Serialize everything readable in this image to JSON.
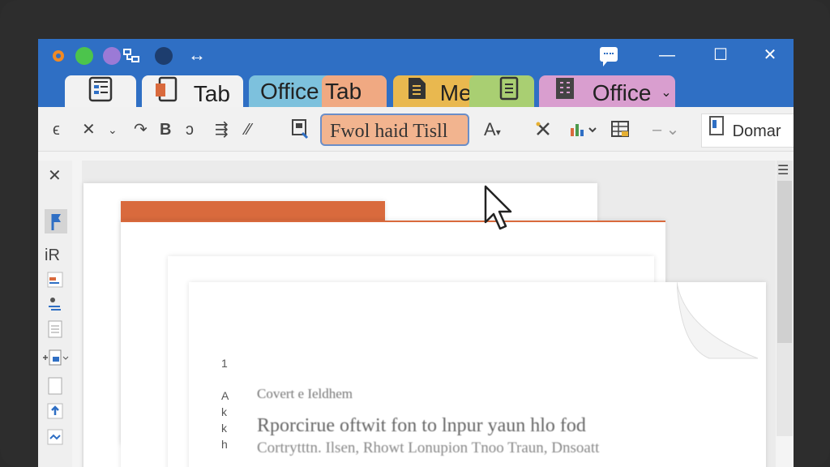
{
  "window": {
    "minimize_glyph": "—",
    "maximize_glyph": "☐",
    "close_glyph": "✕",
    "nav_glyph": "↔"
  },
  "tabs": [
    {
      "label": "",
      "icon": "document-list-icon"
    },
    {
      "label": "Tab",
      "icon": "document-orange-icon"
    },
    {
      "label": "Office",
      "icon": ""
    },
    {
      "label": "Tab",
      "icon": ""
    },
    {
      "label": "Me",
      "icon": "dark-document-icon"
    },
    {
      "label": "",
      "icon": "document-lines-icon"
    },
    {
      "label": "Office",
      "icon": "building-icon"
    }
  ],
  "ribbon": {
    "items": [
      "ϵ",
      "✕",
      "⌄",
      "↷",
      "B",
      "ↄ",
      "⇶",
      "⁄⁄"
    ],
    "tooltip": "Fwol haid Tisll",
    "font_color_label": "A",
    "domain_label": "Domar"
  },
  "leftbar": {
    "close_glyph": "✕",
    "ir_label": "iR"
  },
  "document": {
    "caption": "Covert e Ieldhem",
    "line1": "Rporcirue oftwit fon to lnpur yaun hlo fod",
    "line2": "Cortrytttn. Ilsen, Rhowt Lonupion Tnoo Traun, Dnsoatt"
  },
  "colors": {
    "titlebar": "#2f6fc4",
    "tab_active": "#f2f2f2",
    "tab_office_blue": "#7dc1dd",
    "tab_orange": "#f0a982",
    "tab_yellow": "#e9b84f",
    "tab_green": "#a9cf72",
    "tab_pink": "#d99ecf",
    "doc_orange": "#d96a3d"
  }
}
